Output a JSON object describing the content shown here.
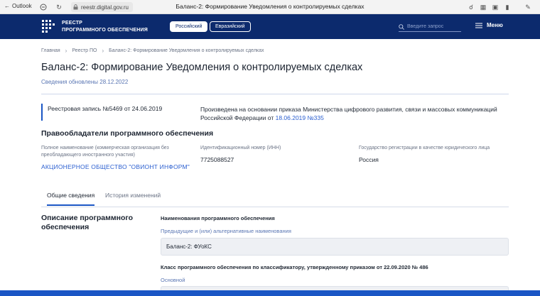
{
  "browser": {
    "back_label": "Outlook",
    "url": "reestr.digital.gov.ru",
    "tab_title": "Баланс-2: Формирование Уведомления о контролируемых сделках"
  },
  "header": {
    "logo_line1": "РЕЕСТР",
    "logo_line2": "ПРОГРАММНОГО ОБЕСПЕЧЕНИЯ",
    "lang_ru": "Российский",
    "lang_eu": "Евразийский",
    "search_placeholder": "Введите запрос",
    "menu_label": "Меню"
  },
  "breadcrumb": {
    "home": "Главная",
    "registry": "Реестр ПО",
    "current": "Баланс-2: Формирование Уведомления о контролируемых сделках"
  },
  "page": {
    "title": "Баланс-2: Формирование Уведомления о контролируемых сделках",
    "updated": "Сведения обновлены 28.12.2022",
    "registry_entry": "Реестровая запись №5469 от 24.06.2019",
    "order_text": "Произведена на основании приказа Министерства цифрового развития, связи и массовых коммуникаций Российской Федерации от ",
    "order_link": "18.06.2019 №335"
  },
  "holders": {
    "title": "Правообладатели программного обеспечения",
    "name_label": "Полное наименование (коммерческая организация без преобладающего иностранного участия)",
    "name_value": "АКЦИОНЕРНОЕ ОБЩЕСТВО \"ОВИОНТ ИНФОРМ\"",
    "inn_label": "Идентификационный номер (ИНН)",
    "inn_value": "7725088527",
    "country_label": "Государство регистрации в качестве юридического лица",
    "country_value": "Россия"
  },
  "tabs": {
    "general": "Общие сведения",
    "history": "История изменений"
  },
  "description": {
    "title": "Описание программного обеспечения",
    "names_heading": "Наименования программного обеспечения",
    "alt_names_label": "Предыдущие и (или) альтернативные наименования",
    "alt_name_value": "Баланс-2: ФУоКС",
    "class_heading": "Класс программного обеспечения по классификатору, утвержденному приказом от 22.09.2020 № 486",
    "main_label": "Основной"
  },
  "colors": {
    "header_bg": "#0c2a6d",
    "accent": "#1a56c5",
    "link": "#2b5fd0"
  }
}
